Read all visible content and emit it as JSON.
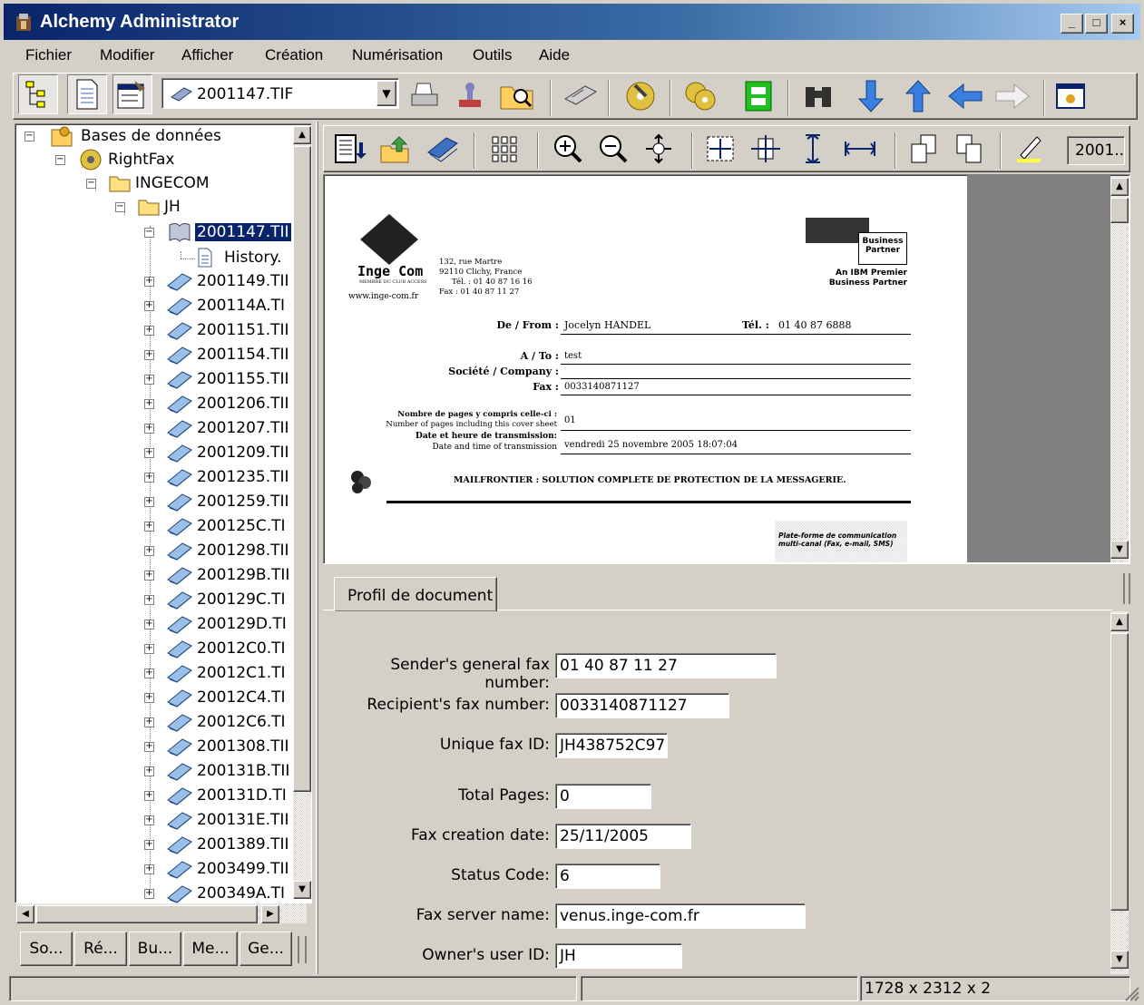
{
  "window": {
    "title": "Alchemy Administrator",
    "min_label": "_",
    "max_label": "□",
    "close_label": "×"
  },
  "menu": [
    "Fichier",
    "Modifier",
    "Afficher",
    "Création",
    "Numérisation",
    "Outils",
    "Aide"
  ],
  "toolbar": {
    "combo_value": "2001147.TIF"
  },
  "tree": {
    "root": "Bases de données",
    "db": "RightFax",
    "folder1": "INGECOM",
    "folder2": "JH",
    "selected": "2001147.TII",
    "history": "History.",
    "items": [
      "2001149.TII",
      "200114A.TI",
      "2001151.TII",
      "2001154.TII",
      "2001155.TII",
      "2001206.TII",
      "2001207.TII",
      "2001209.TII",
      "2001235.TII",
      "2001259.TII",
      "200125C.TI",
      "2001298.TII",
      "200129B.TII",
      "200129C.TI",
      "200129D.TI",
      "20012C0.TI",
      "20012C1.TI",
      "20012C4.TI",
      "20012C6.TI",
      "2001308.TII",
      "200131B.TII",
      "200131D.TI",
      "200131E.TII",
      "2001389.TII",
      "2003499.TII",
      "200349A.TI"
    ]
  },
  "bottom_tabs": [
    "So...",
    "Ré...",
    "Bu...",
    "Me...",
    "Ge..."
  ],
  "viewer": {
    "page_box": "2001..."
  },
  "fax": {
    "logo_name": "Inge Com",
    "logo_sub": "MEMBRE DU CLUB ACCESS",
    "website": "www.inge-com.fr",
    "address": [
      "132, rue Martre",
      "92110 Clichy, France",
      "Tél. : 01 40 87 16 16",
      "Fax : 01 40 87 11 27"
    ],
    "partner_line1": "An IBM Premier",
    "partner_line2": "Business Partner",
    "partner_badge": "Business Partner",
    "from_label": "De / From :",
    "from_value": "Jocelyn HANDEL",
    "tel_label": "Tél. :",
    "tel_value": "01 40 87 6888",
    "to_label": "A / To :",
    "to_value": "test",
    "company_label": "Société / Company :",
    "fax_label": "Fax :",
    "fax_value": "0033140871127",
    "pages_label_fr": "Nombre de pages y compris celle-ci :",
    "pages_label_en": "Number of pages including this cover sheet",
    "pages_value": "01",
    "date_label_fr": "Date et heure de transmission:",
    "date_label_en": "Date and time of transmission",
    "date_value": "vendredi 25 novembre 2005 18:07:04",
    "banner": "MAILFRONTIER : SOLUTION COMPLETE DE PROTECTION DE LA MESSAGERIE.",
    "box_text": "Plate-forme de communication multi-canal (Fax, e-mail, SMS)"
  },
  "profile": {
    "tab": "Profil de document",
    "fields": [
      {
        "label": "Sender's general fax number:",
        "value": "01 40 87 11 27"
      },
      {
        "label": "Recipient's fax number:",
        "value": "0033140871127"
      },
      {
        "label": "Unique fax ID:",
        "value": "JH438752C97"
      },
      {
        "label": "Total Pages:",
        "value": "0"
      },
      {
        "label": "Fax creation date:",
        "value": "25/11/2005"
      },
      {
        "label": "Status Code:",
        "value": "6"
      },
      {
        "label": "Fax server name:",
        "value": "venus.inge-com.fr"
      },
      {
        "label": "Owner's user ID:",
        "value": "JH"
      }
    ]
  },
  "status": {
    "panel1": "",
    "panel2": "",
    "dimensions": "1728 x 2312 x 2"
  }
}
